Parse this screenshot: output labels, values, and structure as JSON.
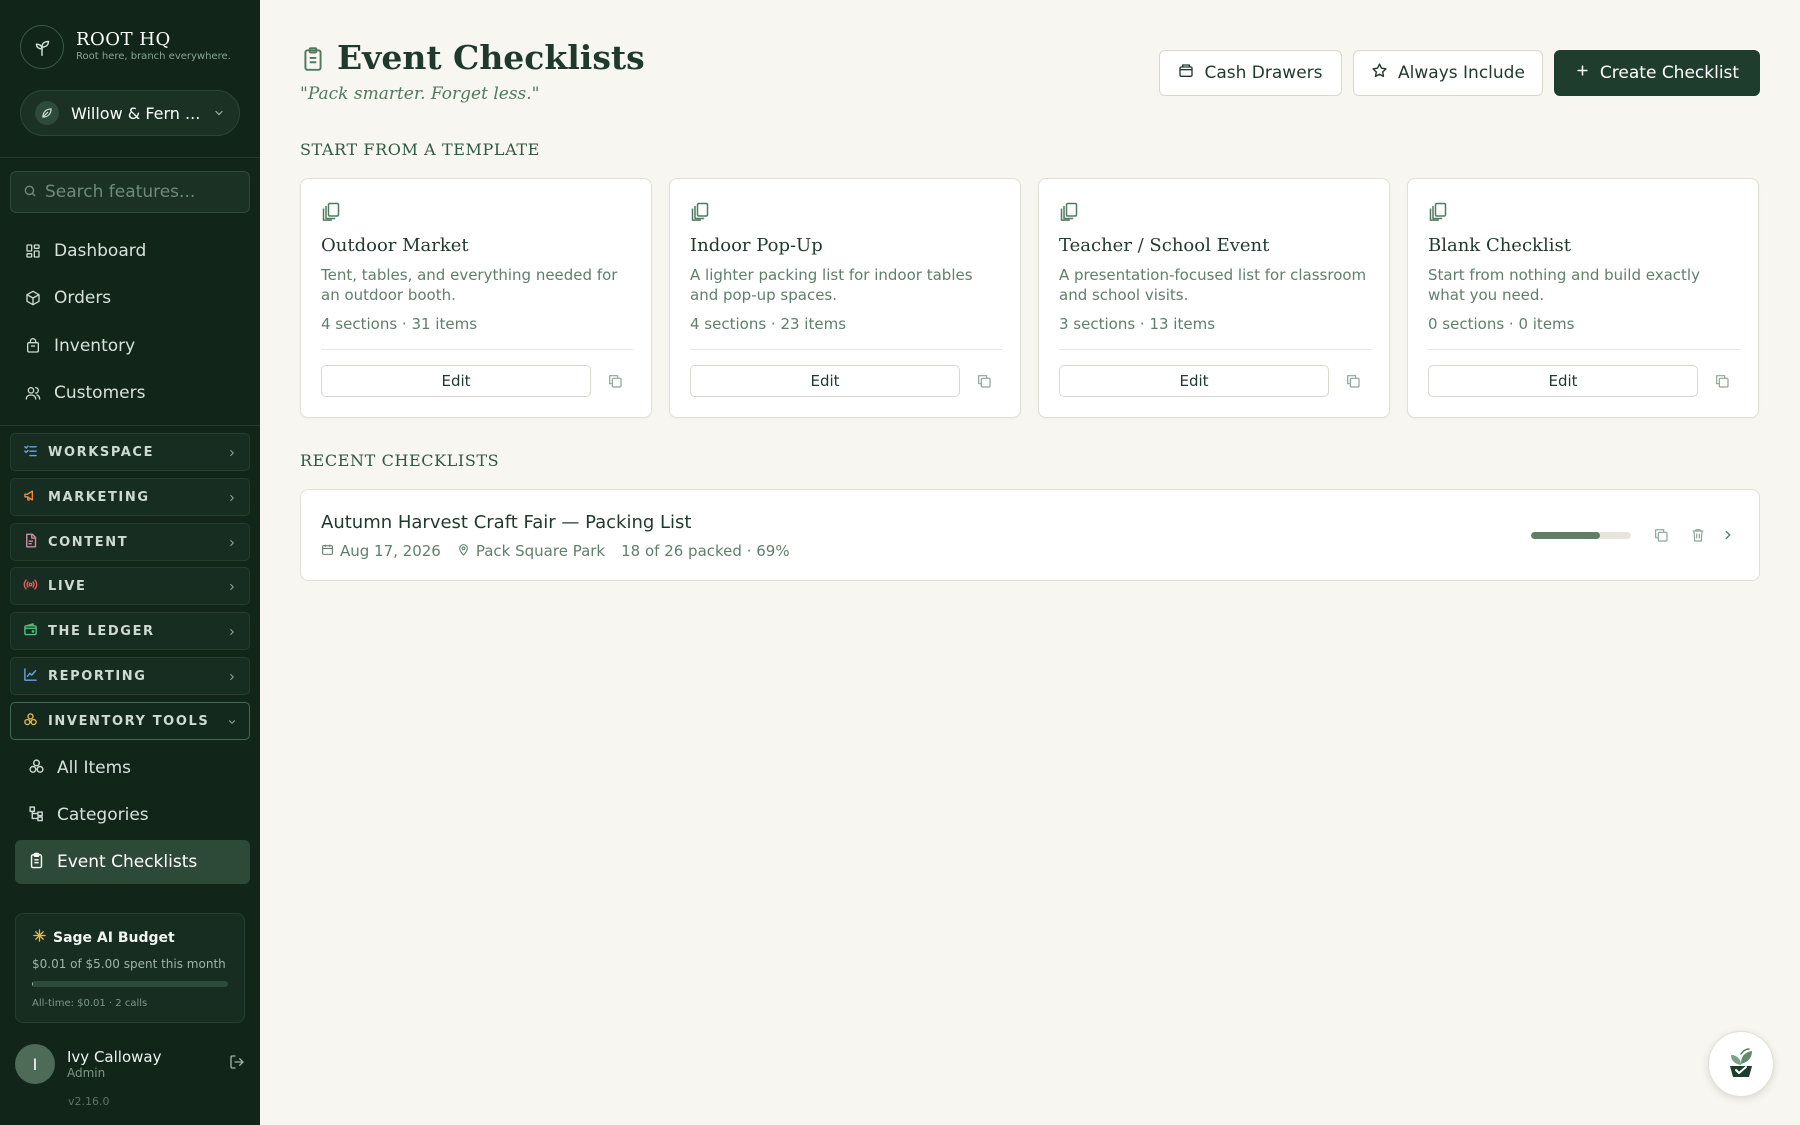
{
  "brand": {
    "name": "ROOT HQ",
    "tagline": "Root here, branch everywhere."
  },
  "store": {
    "name": "Willow & Fern ..."
  },
  "search": {
    "placeholder": "Search features..."
  },
  "nav": [
    {
      "label": "Dashboard",
      "icon": "dashboard-icon"
    },
    {
      "label": "Orders",
      "icon": "box-icon"
    },
    {
      "label": "Inventory",
      "icon": "bag-icon"
    },
    {
      "label": "Customers",
      "icon": "users-icon"
    }
  ],
  "groups": [
    {
      "label": "WORKSPACE",
      "icon": "list-check-icon",
      "color": "#6aa2e8"
    },
    {
      "label": "MARKETING",
      "icon": "megaphone-icon",
      "color": "#e88a4a"
    },
    {
      "label": "CONTENT",
      "icon": "document-icon",
      "color": "#d48aa8"
    },
    {
      "label": "LIVE",
      "icon": "broadcast-icon",
      "color": "#e85a5a"
    },
    {
      "label": "THE LEDGER",
      "icon": "wallet-icon",
      "color": "#4ec27a"
    },
    {
      "label": "REPORTING",
      "icon": "chart-line-icon",
      "color": "#6aa2e8"
    },
    {
      "label": "INVENTORY TOOLS",
      "icon": "boxes-icon",
      "color": "#e8b64a"
    }
  ],
  "subnav": [
    {
      "label": "All Items",
      "icon": "boxes-icon"
    },
    {
      "label": "Categories",
      "icon": "hierarchy-icon"
    },
    {
      "label": "Event Checklists",
      "icon": "clipboard-icon"
    }
  ],
  "budget": {
    "title": "Sage AI Budget",
    "spent": "$0.01 of $5.00 spent this month",
    "fraction": 0.002,
    "alltime": "All-time: $0.01 · 2 calls"
  },
  "user": {
    "initial": "I",
    "name": "Ivy Calloway",
    "role": "Admin"
  },
  "version": "v2.16.0",
  "page": {
    "title": "Event Checklists",
    "subtitle": "\"Pack smarter. Forget less.\""
  },
  "actions": {
    "cash_drawers": "Cash Drawers",
    "always_include": "Always Include",
    "create": "Create Checklist"
  },
  "sections": {
    "templates": "START FROM A TEMPLATE",
    "recent": "RECENT CHECKLISTS"
  },
  "templates": [
    {
      "title": "Outdoor Market",
      "desc": "Tent, tables, and everything needed for an outdoor booth.",
      "meta": "4 sections · 31 items",
      "edit": "Edit"
    },
    {
      "title": "Indoor Pop-Up",
      "desc": "A lighter packing list for indoor tables and pop-up spaces.",
      "meta": "4 sections · 23 items",
      "edit": "Edit"
    },
    {
      "title": "Teacher / School Event",
      "desc": "A presentation-focused list for classroom and school visits.",
      "meta": "3 sections · 13 items",
      "edit": "Edit"
    },
    {
      "title": "Blank Checklist",
      "desc": "Start from nothing and build exactly what you need.",
      "meta": "0 sections · 0 items",
      "edit": "Edit"
    }
  ],
  "recent": [
    {
      "title": "Autumn Harvest Craft Fair — Packing List",
      "date": "Aug 17, 2026",
      "location": "Pack Square Park",
      "progress": "18 of 26 packed · 69%",
      "fraction": 0.69
    }
  ],
  "colors": {
    "sidebar": "#112519",
    "primary": "#1e3d2d",
    "accent": "#4e7a5d",
    "background": "#f7f6f1"
  }
}
